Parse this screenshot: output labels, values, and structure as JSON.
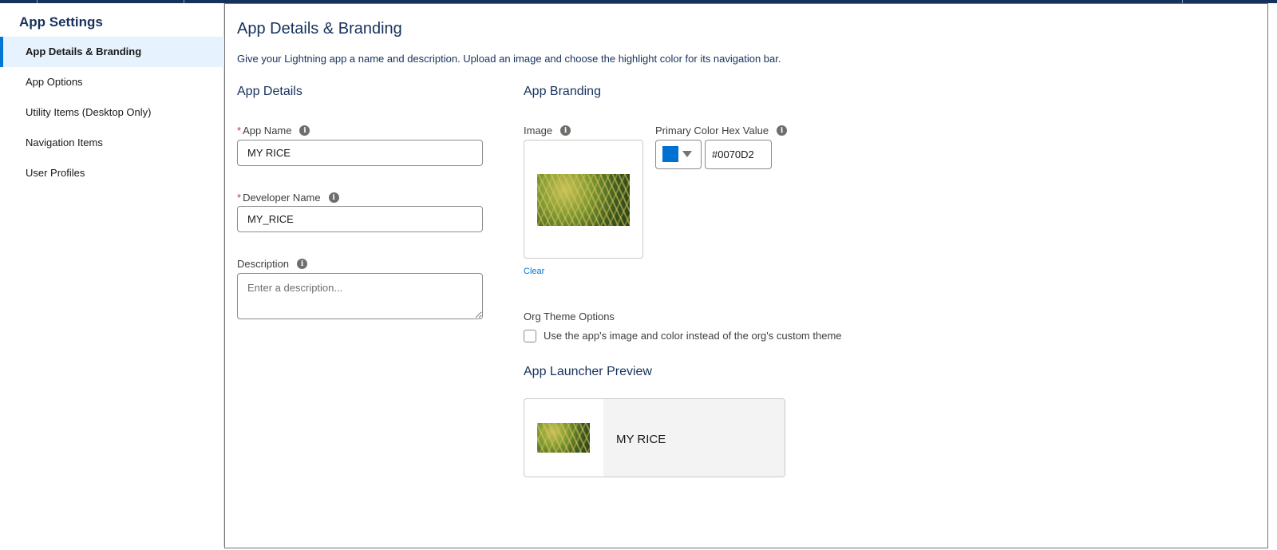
{
  "sidebar": {
    "title": "App Settings",
    "items": [
      {
        "label": "App Details & Branding",
        "active": true
      },
      {
        "label": "App Options",
        "active": false
      },
      {
        "label": "Utility Items (Desktop Only)",
        "active": false
      },
      {
        "label": "Navigation Items",
        "active": false
      },
      {
        "label": "User Profiles",
        "active": false
      }
    ]
  },
  "main": {
    "title": "App Details & Branding",
    "description": "Give your Lightning app a name and description. Upload an image and choose the highlight color for its navigation bar.",
    "details": {
      "section_title": "App Details",
      "app_name_label": "App Name",
      "app_name_value": "MY RICE",
      "developer_name_label": "Developer Name",
      "developer_name_value": "MY_RICE",
      "description_label": "Description",
      "description_placeholder": "Enter a description..."
    },
    "branding": {
      "section_title": "App Branding",
      "image_label": "Image",
      "clear_label": "Clear",
      "primary_color_label": "Primary Color Hex Value",
      "primary_color_value": "#0070D2",
      "org_theme_label": "Org Theme Options",
      "org_theme_checkbox_label": "Use the app's image and color instead of the org's custom theme",
      "org_theme_checked": false
    },
    "preview": {
      "section_title": "App Launcher Preview",
      "app_name": "MY RICE"
    }
  },
  "colors": {
    "accent": "#0176d3",
    "title_navy": "#16325c",
    "active_bg": "#e6f2fd",
    "required": "#c23934",
    "swatch": "#0070D2"
  },
  "icons": {
    "info": "info-icon",
    "dropdown": "chevron-down-icon"
  }
}
